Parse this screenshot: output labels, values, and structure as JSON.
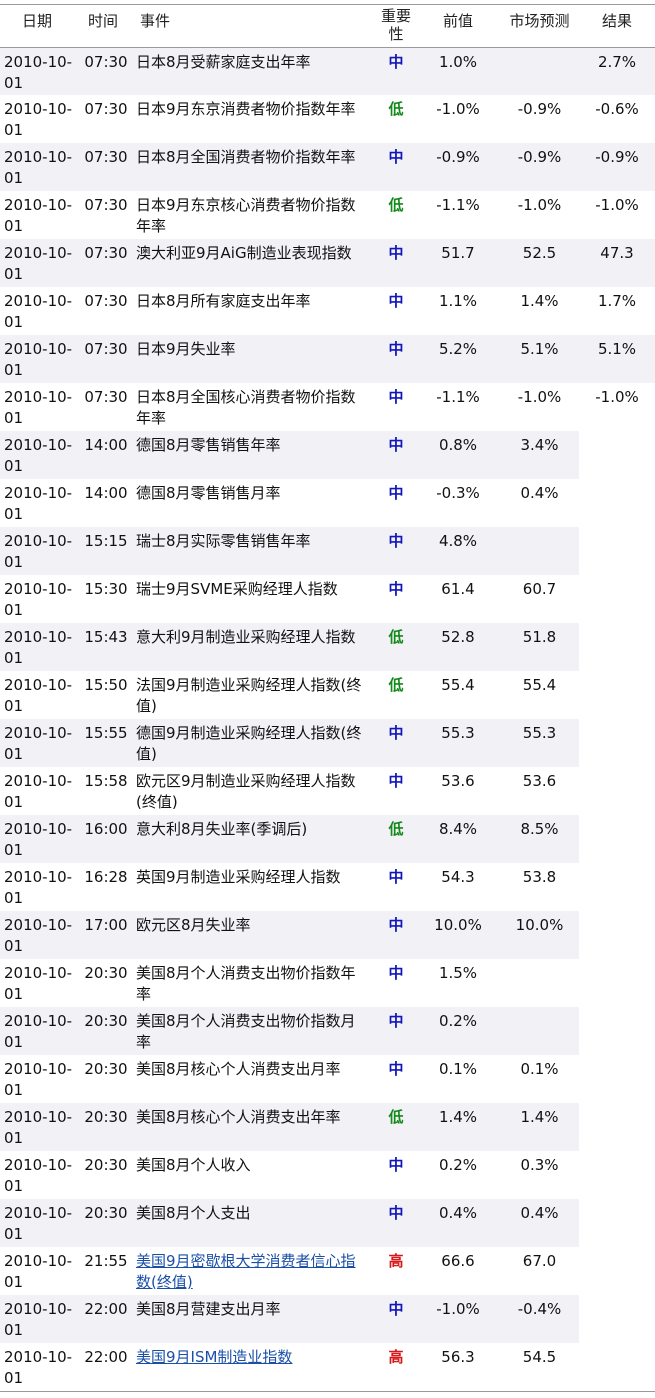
{
  "header": {
    "date": "日期",
    "time": "时间",
    "event": "事件",
    "importance": "重要性",
    "previous": "前值",
    "forecast": "市场预测",
    "result": "结果"
  },
  "colors": {
    "importance_mid": "#1016b8",
    "importance_low": "#148a1a",
    "importance_high": "#d61818",
    "link": "#1a4fa8",
    "row_shade": "#f2f1f6"
  },
  "rows": [
    {
      "date": "2010-10-01",
      "time": "07:30",
      "event": "日本8月受薪家庭支出年率",
      "importance": "中",
      "level": "mid",
      "previous": "1.0%",
      "forecast": "",
      "result": "2.7%",
      "link": false
    },
    {
      "date": "2010-10-01",
      "time": "07:30",
      "event": "日本9月东京消费者物价指数年率",
      "importance": "低",
      "level": "low",
      "previous": "-1.0%",
      "forecast": "-0.9%",
      "result": "-0.6%",
      "link": false
    },
    {
      "date": "2010-10-01",
      "time": "07:30",
      "event": "日本8月全国消费者物价指数年率",
      "importance": "中",
      "level": "mid",
      "previous": "-0.9%",
      "forecast": "-0.9%",
      "result": "-0.9%",
      "link": false
    },
    {
      "date": "2010-10-01",
      "time": "07:30",
      "event": "日本9月东京核心消费者物价指数年率",
      "importance": "低",
      "level": "low",
      "previous": "-1.1%",
      "forecast": "-1.0%",
      "result": "-1.0%",
      "link": false
    },
    {
      "date": "2010-10-01",
      "time": "07:30",
      "event": "澳大利亚9月AiG制造业表现指数",
      "importance": "中",
      "level": "mid",
      "previous": "51.7",
      "forecast": "52.5",
      "result": "47.3",
      "link": false
    },
    {
      "date": "2010-10-01",
      "time": "07:30",
      "event": "日本8月所有家庭支出年率",
      "importance": "中",
      "level": "mid",
      "previous": "1.1%",
      "forecast": "1.4%",
      "result": "1.7%",
      "link": false
    },
    {
      "date": "2010-10-01",
      "time": "07:30",
      "event": "日本9月失业率",
      "importance": "中",
      "level": "mid",
      "previous": "5.2%",
      "forecast": "5.1%",
      "result": "5.1%",
      "link": false
    },
    {
      "date": "2010-10-01",
      "time": "07:30",
      "event": "日本8月全国核心消费者物价指数年率",
      "importance": "中",
      "level": "mid",
      "previous": "-1.1%",
      "forecast": "-1.0%",
      "result": "-1.0%",
      "link": false
    },
    {
      "date": "2010-10-01",
      "time": "14:00",
      "event": "德国8月零售销售年率",
      "importance": "中",
      "level": "mid",
      "previous": "0.8%",
      "forecast": "3.4%",
      "result": "",
      "link": false
    },
    {
      "date": "2010-10-01",
      "time": "14:00",
      "event": "德国8月零售销售月率",
      "importance": "中",
      "level": "mid",
      "previous": "-0.3%",
      "forecast": "0.4%",
      "result": "",
      "link": false
    },
    {
      "date": "2010-10-01",
      "time": "15:15",
      "event": "瑞士8月实际零售销售年率",
      "importance": "中",
      "level": "mid",
      "previous": "4.8%",
      "forecast": "",
      "result": "",
      "link": false
    },
    {
      "date": "2010-10-01",
      "time": "15:30",
      "event": "瑞士9月SVME采购经理人指数",
      "importance": "中",
      "level": "mid",
      "previous": "61.4",
      "forecast": "60.7",
      "result": "",
      "link": false
    },
    {
      "date": "2010-10-01",
      "time": "15:43",
      "event": "意大利9月制造业采购经理人指数",
      "importance": "低",
      "level": "low",
      "previous": "52.8",
      "forecast": "51.8",
      "result": "",
      "link": false
    },
    {
      "date": "2010-10-01",
      "time": "15:50",
      "event": "法国9月制造业采购经理人指数(终值)",
      "importance": "低",
      "level": "low",
      "previous": "55.4",
      "forecast": "55.4",
      "result": "",
      "link": false
    },
    {
      "date": "2010-10-01",
      "time": "15:55",
      "event": "德国9月制造业采购经理人指数(终值)",
      "importance": "中",
      "level": "mid",
      "previous": "55.3",
      "forecast": "55.3",
      "result": "",
      "link": false
    },
    {
      "date": "2010-10-01",
      "time": "15:58",
      "event": "欧元区9月制造业采购经理人指数(终值)",
      "importance": "中",
      "level": "mid",
      "previous": "53.6",
      "forecast": "53.6",
      "result": "",
      "link": false
    },
    {
      "date": "2010-10-01",
      "time": "16:00",
      "event": "意大利8月失业率(季调后)",
      "importance": "低",
      "level": "low",
      "previous": "8.4%",
      "forecast": "8.5%",
      "result": "",
      "link": false
    },
    {
      "date": "2010-10-01",
      "time": "16:28",
      "event": "英国9月制造业采购经理人指数",
      "importance": "中",
      "level": "mid",
      "previous": "54.3",
      "forecast": "53.8",
      "result": "",
      "link": false
    },
    {
      "date": "2010-10-01",
      "time": "17:00",
      "event": "欧元区8月失业率",
      "importance": "中",
      "level": "mid",
      "previous": "10.0%",
      "forecast": "10.0%",
      "result": "",
      "link": false
    },
    {
      "date": "2010-10-01",
      "time": "20:30",
      "event": "美国8月个人消费支出物价指数年率",
      "importance": "中",
      "level": "mid",
      "previous": "1.5%",
      "forecast": "",
      "result": "",
      "link": false
    },
    {
      "date": "2010-10-01",
      "time": "20:30",
      "event": "美国8月个人消费支出物价指数月率",
      "importance": "中",
      "level": "mid",
      "previous": "0.2%",
      "forecast": "",
      "result": "",
      "link": false
    },
    {
      "date": "2010-10-01",
      "time": "20:30",
      "event": "美国8月核心个人消费支出月率",
      "importance": "中",
      "level": "mid",
      "previous": "0.1%",
      "forecast": "0.1%",
      "result": "",
      "link": false
    },
    {
      "date": "2010-10-01",
      "time": "20:30",
      "event": "美国8月核心个人消费支出年率",
      "importance": "低",
      "level": "low",
      "previous": "1.4%",
      "forecast": "1.4%",
      "result": "",
      "link": false
    },
    {
      "date": "2010-10-01",
      "time": "20:30",
      "event": "美国8月个人收入",
      "importance": "中",
      "level": "mid",
      "previous": "0.2%",
      "forecast": "0.3%",
      "result": "",
      "link": false
    },
    {
      "date": "2010-10-01",
      "time": "20:30",
      "event": "美国8月个人支出",
      "importance": "中",
      "level": "mid",
      "previous": "0.4%",
      "forecast": "0.4%",
      "result": "",
      "link": false
    },
    {
      "date": "2010-10-01",
      "time": "21:55",
      "event": "美国9月密歇根大学消费者信心指数(终值)",
      "importance": "高",
      "level": "high",
      "previous": "66.6",
      "forecast": "67.0",
      "result": "",
      "link": true
    },
    {
      "date": "2010-10-01",
      "time": "22:00",
      "event": "美国8月营建支出月率",
      "importance": "中",
      "level": "mid",
      "previous": "-1.0%",
      "forecast": "-0.4%",
      "result": "",
      "link": false
    },
    {
      "date": "2010-10-01",
      "time": "22:00",
      "event": "美国9月ISM制造业指数",
      "importance": "高",
      "level": "high",
      "previous": "56.3",
      "forecast": "54.5",
      "result": "",
      "link": true
    }
  ]
}
